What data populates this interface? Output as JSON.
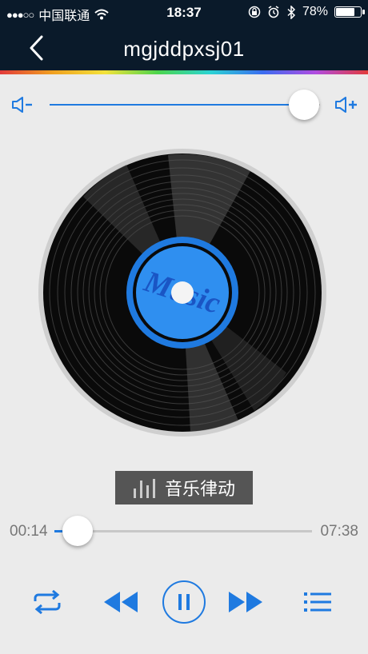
{
  "status_bar": {
    "signal": "●●●○○",
    "carrier": "中国联通",
    "time": "18:37",
    "battery_percent": "78%",
    "battery_level": 0.78
  },
  "header": {
    "title": "mgjddpxsj01"
  },
  "volume": {
    "level": 0.94
  },
  "record": {
    "label_text": "Music"
  },
  "rhythm_button": {
    "label": "音乐律动"
  },
  "progress": {
    "current": "00:14",
    "duration": "07:38",
    "fraction": 0.09
  },
  "colors": {
    "accent": "#1f7ae0",
    "header_bg": "#0a1a2a",
    "background": "#ebebeb"
  },
  "icons": {
    "back": "chevron-left-icon",
    "volume_down": "speaker-minus-icon",
    "volume_up": "speaker-plus-icon",
    "rhythm": "equalizer-bars-icon",
    "repeat": "repeat-icon",
    "prev": "rewind-icon",
    "play_pause": "pause-icon",
    "next": "fast-forward-icon",
    "playlist": "list-icon"
  }
}
